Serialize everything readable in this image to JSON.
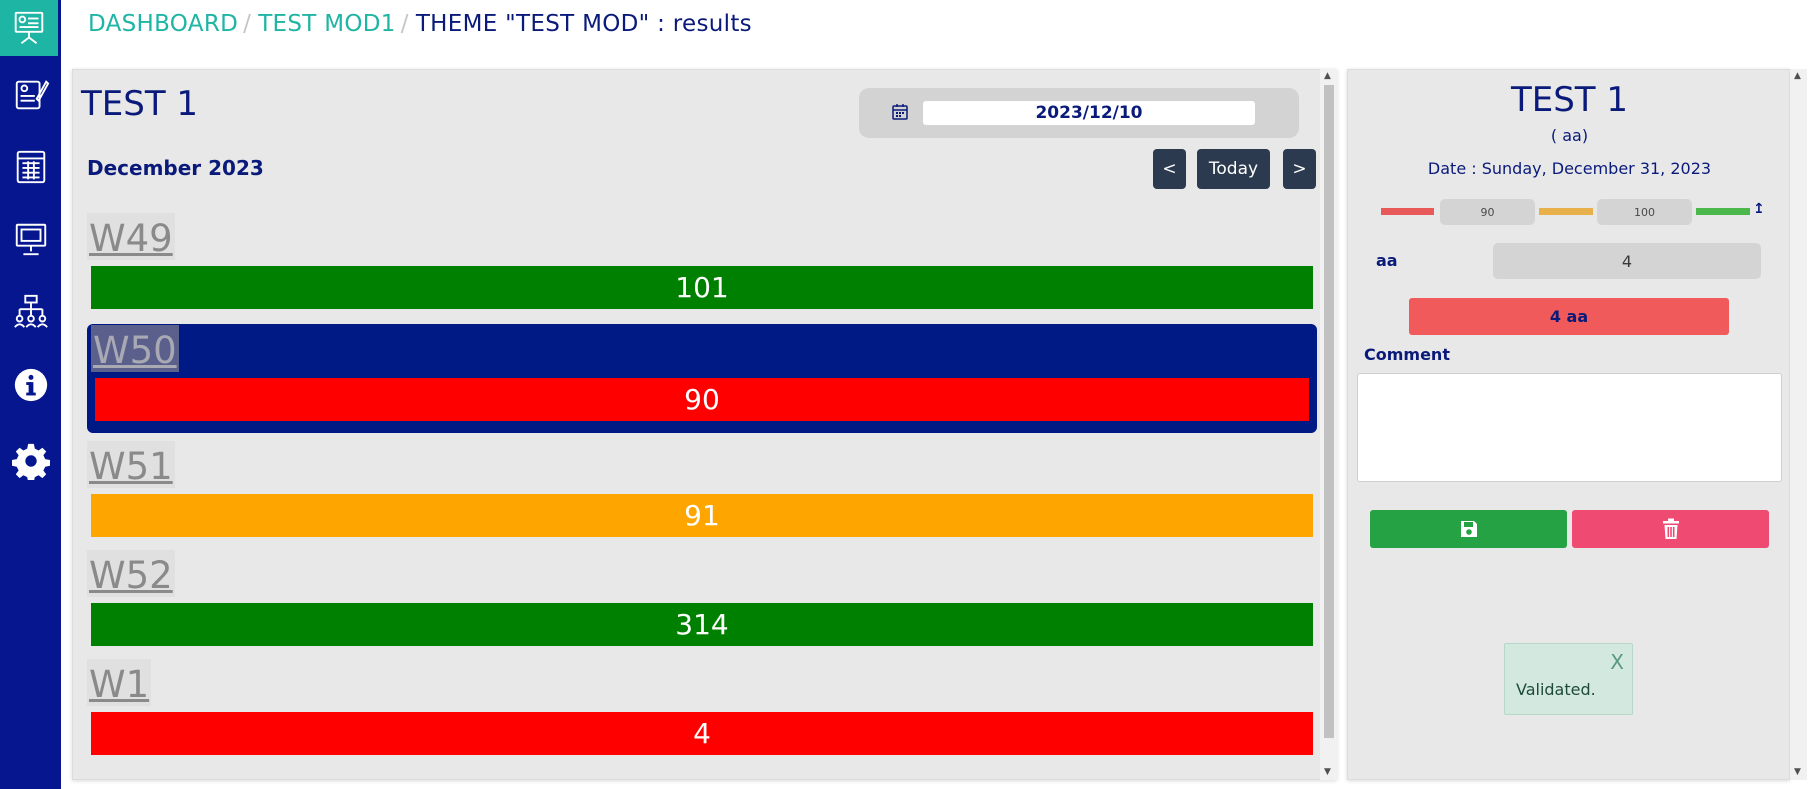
{
  "breadcrumb": {
    "items": [
      "DASHBOARD",
      "TEST MOD1"
    ],
    "separator": "/",
    "current": "THEME \"TEST MOD\" : results"
  },
  "sidebar": {
    "items": [
      {
        "icon": "presentation-board-icon",
        "active": true
      },
      {
        "icon": "checklist-pencil-icon",
        "active": false
      },
      {
        "icon": "spreadsheet-icon",
        "active": false
      },
      {
        "icon": "projector-screen-icon",
        "active": false
      },
      {
        "icon": "org-chart-icon",
        "active": false
      },
      {
        "icon": "info-icon",
        "active": false
      },
      {
        "icon": "gear-icon",
        "active": false
      }
    ]
  },
  "main": {
    "title": "TEST 1",
    "date_value": "2023/12/10",
    "month_label": "December 2023",
    "nav": {
      "prev": "<",
      "today": "Today",
      "next": ">"
    },
    "weeks": [
      {
        "label": "W49",
        "value": "101",
        "color": "#008000",
        "selected": false
      },
      {
        "label": "W50",
        "value": "90",
        "color": "#ff0000",
        "selected": true
      },
      {
        "label": "W51",
        "value": "91",
        "color": "#ffa500",
        "selected": false
      },
      {
        "label": "W52",
        "value": "314",
        "color": "#008000",
        "selected": false
      },
      {
        "label": "W1",
        "value": "4",
        "color": "#ff0000",
        "selected": false
      }
    ]
  },
  "detail": {
    "title": "TEST 1",
    "subtitle": "( aa)",
    "date_line": "Date : Sunday, December 31, 2023",
    "thresholds": {
      "low": "90",
      "high": "100",
      "arrow": "↥"
    },
    "unit_label": "aa",
    "unit_value": "4",
    "result_badge": "4 aa",
    "comment_label": "Comment",
    "comment_value": "",
    "toast": {
      "message": "Validated.",
      "close": "X"
    }
  },
  "colors": {
    "sidebar": "#06168f",
    "active_nav": "#1fb5a4",
    "selected_week": "#001a85",
    "save": "#25a244",
    "delete": "#ef4a72",
    "badge_red": "#f05a5a",
    "threshold_red": "#e85a5a",
    "threshold_orange": "#e8b04a",
    "threshold_green": "#4cb84c"
  }
}
